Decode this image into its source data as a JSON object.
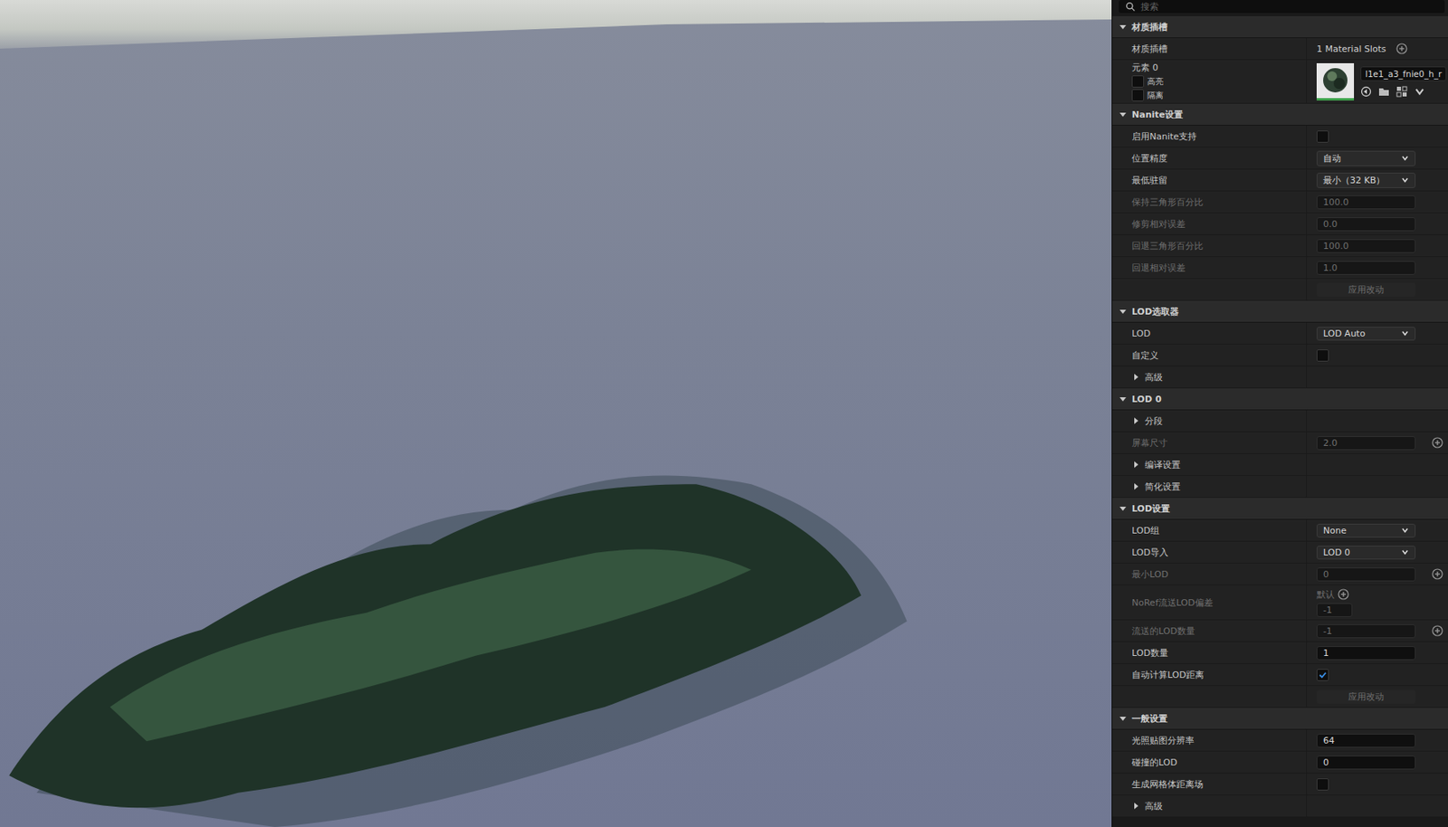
{
  "search": {
    "placeholder": "搜索"
  },
  "viewport": {
    "kind": "render"
  },
  "sections": [
    {
      "title": "材质插槽",
      "expanded": true,
      "rows": [
        {
          "kind": "number",
          "label": "材质插槽",
          "value": "1 Material Slots",
          "disabled": false,
          "add": true,
          "plain": true
        },
        {
          "kind": "element",
          "label": "元素 0",
          "checks": [
            {
              "label": "高亮",
              "checked": false
            },
            {
              "label": "隔离",
              "checked": false
            }
          ],
          "material": "l1e1_a3_fnie0_h_r"
        }
      ]
    },
    {
      "title": "Nanite设置",
      "expanded": true,
      "rows": [
        {
          "kind": "checkbox",
          "label": "启用Nanite支持",
          "checked": false,
          "disabled": false
        },
        {
          "kind": "dropdown",
          "label": "位置精度",
          "value": "自动"
        },
        {
          "kind": "dropdown",
          "label": "最低驻留",
          "value": "最小（32 KB）"
        },
        {
          "kind": "number",
          "label": "保持三角形百分比",
          "value": "100.0",
          "disabled": true,
          "add": false,
          "plain": false
        },
        {
          "kind": "number",
          "label": "修剪相对误差",
          "value": "0.0",
          "disabled": true,
          "add": false,
          "plain": false
        },
        {
          "kind": "number",
          "label": "回退三角形百分比",
          "value": "100.0",
          "disabled": true,
          "add": false,
          "plain": false
        },
        {
          "kind": "number",
          "label": "回退相对误差",
          "value": "1.0",
          "disabled": true,
          "add": false,
          "plain": false
        },
        {
          "kind": "button",
          "label": "应用改动",
          "disabled": true
        }
      ]
    },
    {
      "title": "LOD选取器",
      "expanded": true,
      "rows": [
        {
          "kind": "dropdown",
          "label": "LOD",
          "value": "LOD Auto"
        },
        {
          "kind": "checkbox",
          "label": "自定义",
          "checked": false,
          "disabled": false
        },
        {
          "kind": "group",
          "label": "高级",
          "expanded": false
        }
      ]
    },
    {
      "title": "LOD 0",
      "expanded": true,
      "rows": [
        {
          "kind": "group",
          "label": "分段",
          "expanded": false
        },
        {
          "kind": "number",
          "label": "屏幕尺寸",
          "value": "2.0",
          "disabled": true,
          "add": true,
          "plain": false
        },
        {
          "kind": "group",
          "label": "编译设置",
          "expanded": false
        },
        {
          "kind": "group",
          "label": "简化设置",
          "expanded": false
        }
      ]
    },
    {
      "title": "LOD设置",
      "expanded": true,
      "rows": [
        {
          "kind": "dropdown",
          "label": "LOD组",
          "value": "None"
        },
        {
          "kind": "dropdown",
          "label": "LOD导入",
          "value": "LOD 0"
        },
        {
          "kind": "number",
          "label": "最小LOD",
          "value": "0",
          "disabled": true,
          "add": true,
          "plain": false
        },
        {
          "kind": "noref",
          "label": "NoRef流送LOD偏差",
          "default_label": "默认",
          "value": "-1",
          "disabled": true
        },
        {
          "kind": "number",
          "label": "流送的LOD数量",
          "value": "-1",
          "disabled": true,
          "add": true,
          "plain": false
        },
        {
          "kind": "number",
          "label": "LOD数量",
          "value": "1",
          "disabled": false,
          "add": false,
          "plain": false
        },
        {
          "kind": "checkbox",
          "label": "自动计算LOD距离",
          "checked": true,
          "disabled": false
        },
        {
          "kind": "button",
          "label": "应用改动",
          "disabled": true
        }
      ]
    },
    {
      "title": "一般设置",
      "expanded": true,
      "rows": [
        {
          "kind": "number",
          "label": "光照贴图分辨率",
          "value": "64",
          "disabled": false,
          "add": false,
          "plain": false
        },
        {
          "kind": "number",
          "label": "碰撞的LOD",
          "value": "0",
          "disabled": false,
          "add": false,
          "plain": false
        },
        {
          "kind": "checkbox",
          "label": "生成网格体距离场",
          "checked": false,
          "disabled": false
        },
        {
          "kind": "group",
          "label": "高级",
          "expanded": false
        }
      ]
    }
  ]
}
